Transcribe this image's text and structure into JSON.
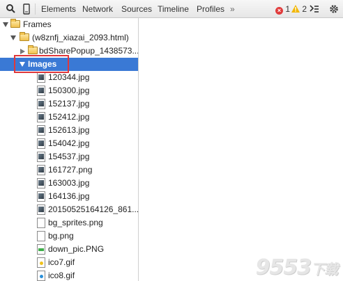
{
  "toolbar": {
    "tabs": [
      {
        "label": "Elements"
      },
      {
        "label": "Network"
      },
      {
        "label": "Sources"
      },
      {
        "label": "Timeline"
      },
      {
        "label": "Profiles"
      }
    ],
    "overflow": "»",
    "errors_count": "1",
    "warnings_count": "2",
    "icons": {
      "search": "search-icon",
      "device": "mobile-device-icon",
      "console": "console-drawer-icon",
      "settings": "gear-icon"
    },
    "colors": {
      "error": "#e03b3b",
      "warning": "#f2b600"
    }
  },
  "tree": {
    "root": "Frames",
    "frame": "(w8znfj_xiazai_2093.html)",
    "subframe": "bdSharePopup_1438573...",
    "images_folder": "Images",
    "images": [
      {
        "name": "120344.jpg",
        "icon": "thumbnail"
      },
      {
        "name": "150300.jpg",
        "icon": "thumbnail"
      },
      {
        "name": "152137.jpg",
        "icon": "thumbnail"
      },
      {
        "name": "152412.jpg",
        "icon": "thumbnail"
      },
      {
        "name": "152613.jpg",
        "icon": "thumbnail"
      },
      {
        "name": "154042.jpg",
        "icon": "thumbnail"
      },
      {
        "name": "154537.jpg",
        "icon": "thumbnail"
      },
      {
        "name": "161727.png",
        "icon": "thumbnail"
      },
      {
        "name": "163003.jpg",
        "icon": "thumbnail"
      },
      {
        "name": "164136.jpg",
        "icon": "thumbnail"
      },
      {
        "name": "20150525164126_861...",
        "icon": "thumbnail"
      },
      {
        "name": "bg_sprites.png",
        "icon": "blank"
      },
      {
        "name": "bg.png",
        "icon": "blank"
      },
      {
        "name": "down_pic.PNG",
        "icon": "green"
      },
      {
        "name": "ico7.gif",
        "icon": "yellow"
      },
      {
        "name": "ico8.gif",
        "icon": "blue"
      }
    ],
    "selected_color": "#3a79d5",
    "highlight_color": "#e0383b"
  },
  "watermark": "9553下载"
}
